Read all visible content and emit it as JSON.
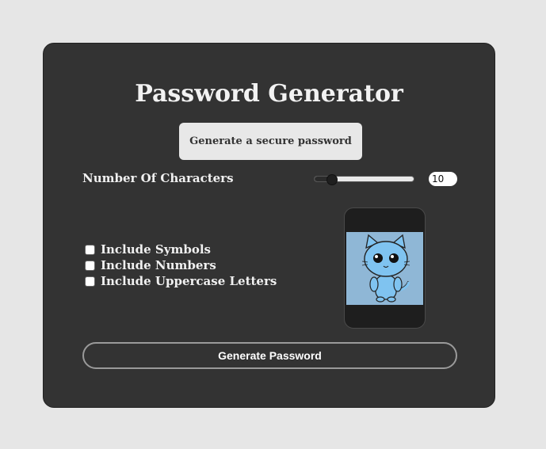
{
  "app": {
    "title": "Password Generator",
    "subtitle": "Generate a secure password"
  },
  "length": {
    "label": "Number Of Characters",
    "value": "10",
    "slider_min": 4,
    "slider_max": 40,
    "slider_value": 10
  },
  "options": [
    {
      "label": "Include Symbols",
      "checked": false
    },
    {
      "label": "Include Numbers",
      "checked": false
    },
    {
      "label": "Include Uppercase Letters",
      "checked": false
    }
  ],
  "illustration": {
    "icon": "cat-phone-illustration",
    "screen_color": "#8fb7d6",
    "cat_color": "#7fc3f0"
  },
  "actions": {
    "generate_label": "Generate Password"
  },
  "colors": {
    "page_bg": "#e6e6e6",
    "card_bg": "#333333",
    "text": "#f0f0f0"
  }
}
